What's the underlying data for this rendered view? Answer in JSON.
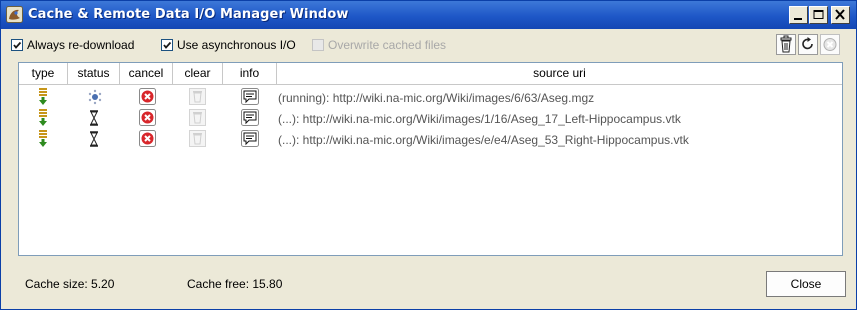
{
  "window": {
    "title": "Cache & Remote Data I/O Manager Window",
    "controls": [
      "minimize",
      "maximize",
      "close"
    ]
  },
  "toolbar": {
    "always_redownload": {
      "label": "Always re-download",
      "checked": true,
      "enabled": true
    },
    "async_io": {
      "label": "Use asynchronous I/O",
      "checked": true,
      "enabled": true
    },
    "overwrite_cached": {
      "label": "Overwrite cached files",
      "checked": false,
      "enabled": false
    },
    "icons": [
      "trash-icon",
      "refresh-icon",
      "cancel-all-icon"
    ]
  },
  "table": {
    "columns": [
      "type",
      "status",
      "cancel",
      "clear",
      "info",
      "source uri"
    ],
    "rows": [
      {
        "type": "download",
        "status": "running",
        "uri": "(running): http://wiki.na-mic.org/Wiki/images/6/63/Aseg.mgz"
      },
      {
        "type": "download",
        "status": "pending",
        "uri": "(...): http://wiki.na-mic.org/Wiki/images/1/16/Aseg_17_Left-Hippocampus.vtk"
      },
      {
        "type": "download",
        "status": "pending",
        "uri": "(...): http://wiki.na-mic.org/Wiki/images/e/e4/Aseg_53_Right-Hippocampus.vtk"
      }
    ]
  },
  "footer": {
    "cache_size": "Cache size:  5.20",
    "cache_free": "Cache free:  15.80",
    "close_label": "Close"
  },
  "colors": {
    "titlebar": "#1e57c7",
    "cancel": "#d8262b",
    "download_arrow": "#2e8b1f",
    "download_bars": "#c7961a"
  }
}
